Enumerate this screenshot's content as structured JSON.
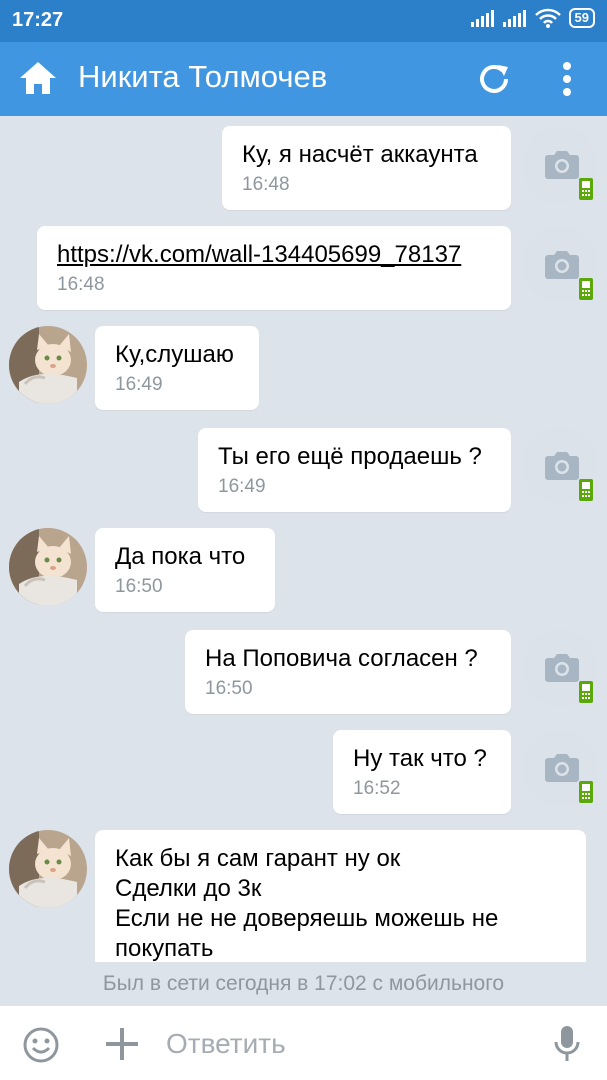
{
  "status_bar": {
    "time": "17:27",
    "battery": "59"
  },
  "header": {
    "title": "Никита Толмочев"
  },
  "messages": [
    {
      "text": "Ку, я насчёт аккаунта",
      "time": "16:48"
    },
    {
      "text": "https://vk.com/wall-134405699_78137",
      "time": "16:48"
    },
    {
      "text": "Ку,слушаю",
      "time": "16:49"
    },
    {
      "text": "Ты его ещё продаешь ?",
      "time": "16:49"
    },
    {
      "text": "Да пока что",
      "time": "16:50"
    },
    {
      "text": "На Поповича согласен ?",
      "time": "16:50"
    },
    {
      "text": "Ну так что ?",
      "time": "16:52"
    },
    {
      "lines": [
        "Как бы я сам гарант ну ок",
        "Сделки до 3к",
        "Если не не доверяешь можешь не покупать"
      ]
    }
  ],
  "last_seen": "Был в сети сегодня в 17:02 с мобильного",
  "composer": {
    "placeholder": "Ответить"
  },
  "colors": {
    "statusbar": "#2c7fc9",
    "appbar": "#4096e0",
    "background": "#dde3ea",
    "link": "#2a5885"
  },
  "icons": [
    "home-icon",
    "refresh-icon",
    "more-vert-icon",
    "camera-icon",
    "mobile-phone-icon",
    "smile-icon",
    "plus-icon",
    "mic-icon"
  ]
}
